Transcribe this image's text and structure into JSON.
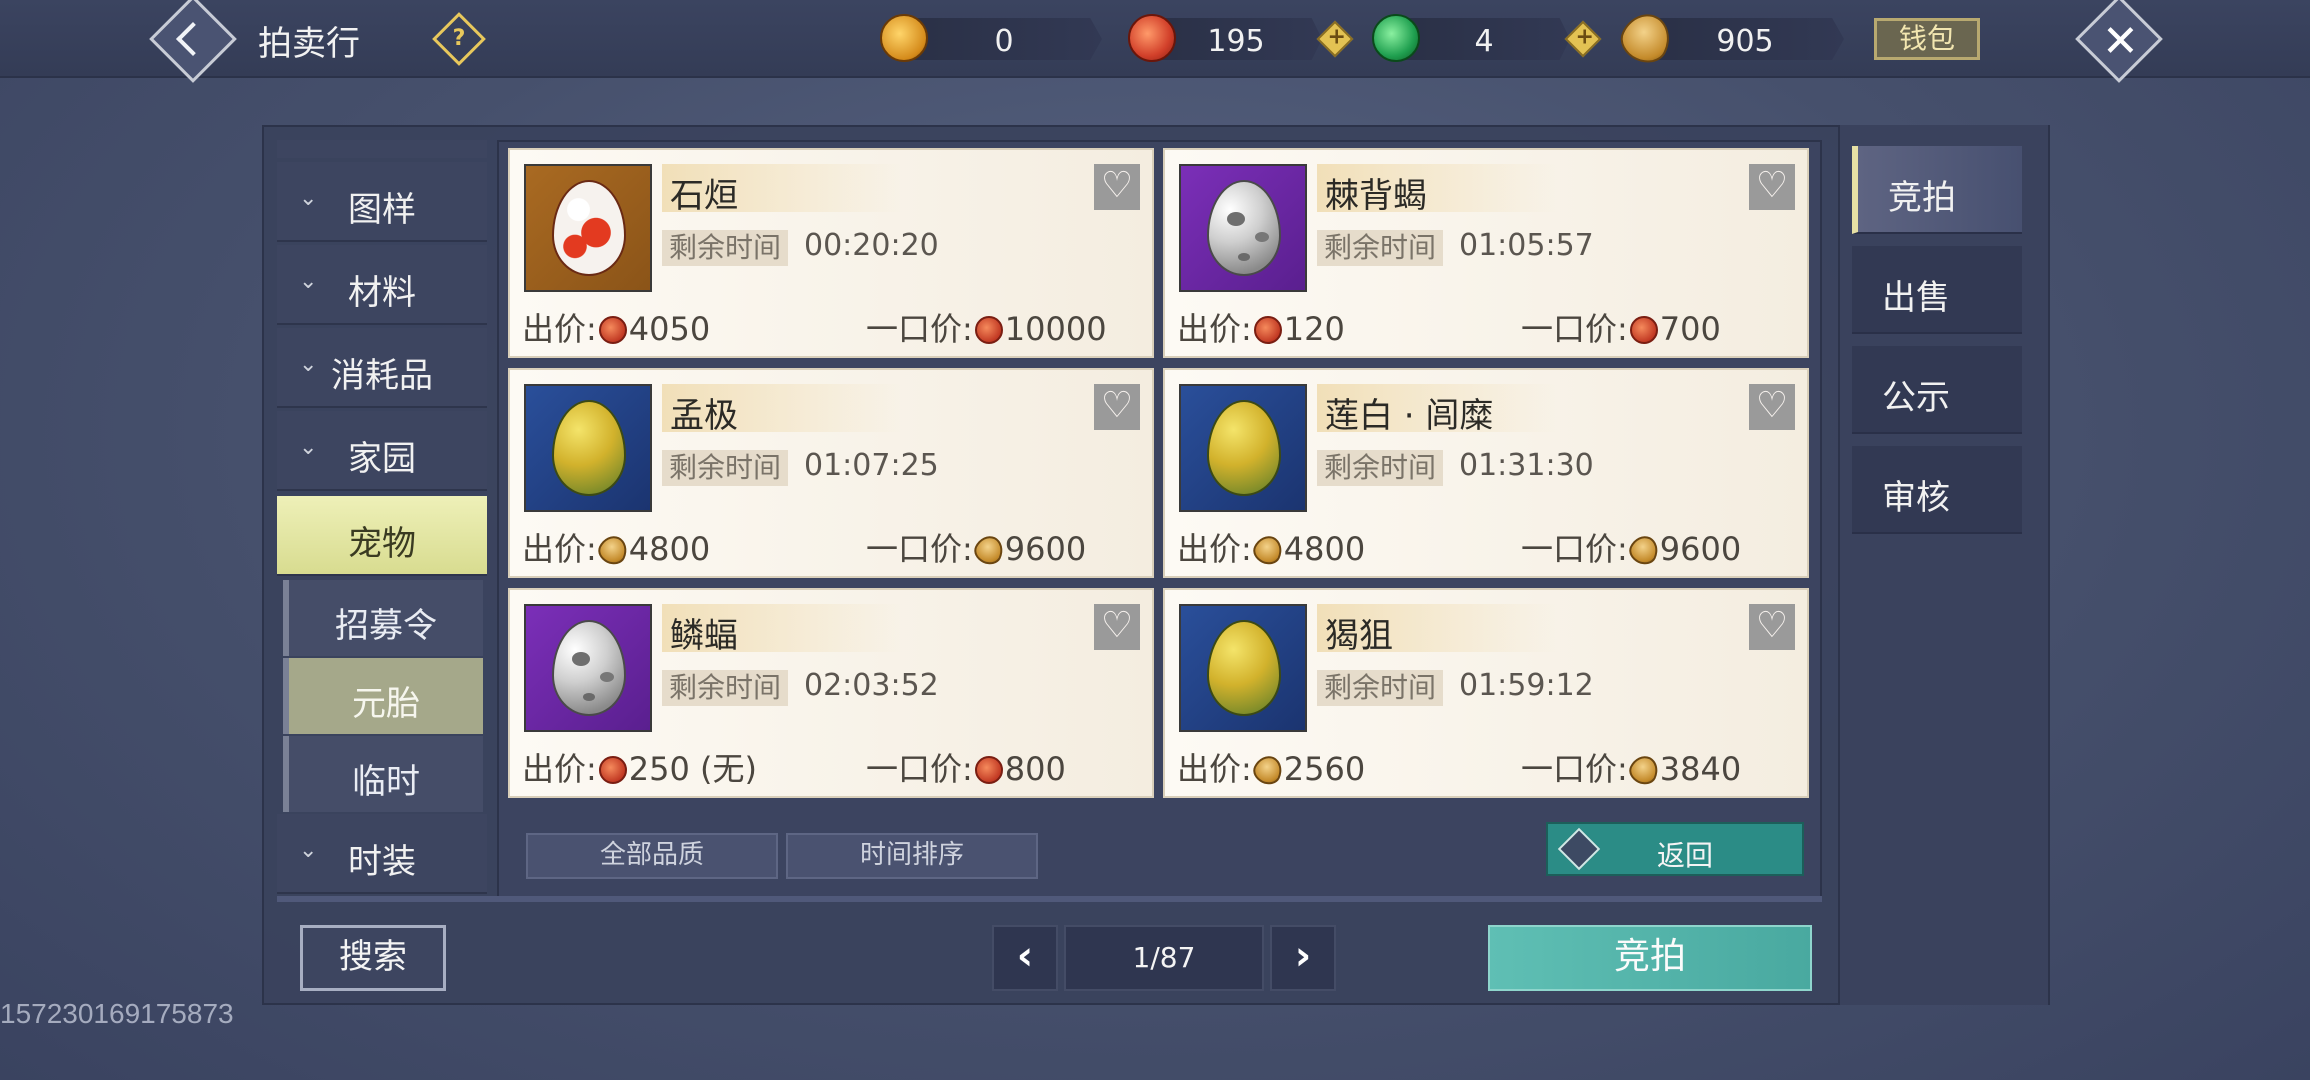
{
  "header": {
    "title": "拍卖行",
    "currencies": [
      {
        "icon": "golden-ring-currency-icon",
        "value": "0"
      },
      {
        "icon": "red-coin-currency-icon",
        "value": "195"
      },
      {
        "icon": "green-jade-currency-icon",
        "value": "4"
      },
      {
        "icon": "seed-currency-icon",
        "value": "905"
      }
    ],
    "wallet_label": "钱包"
  },
  "categories": [
    {
      "label": "图样",
      "expanded": false
    },
    {
      "label": "材料",
      "expanded": false
    },
    {
      "label": "消耗品",
      "expanded": false
    },
    {
      "label": "家园",
      "expanded": false
    },
    {
      "label": "宠物",
      "selected": true
    },
    {
      "label": "时装",
      "expanded": false
    }
  ],
  "subcategories": [
    {
      "label": "招募令"
    },
    {
      "label": "元胎",
      "selected": true
    },
    {
      "label": "临时"
    }
  ],
  "listings": [
    {
      "name": "石烜",
      "egg": "koi",
      "time_label": "剩余时间",
      "time": "00:20:20",
      "bid_label": "出价:",
      "bid": "4050",
      "bid_coin": "red",
      "buyout_label": "一口价:",
      "buyout": "10000",
      "buyout_coin": "red"
    },
    {
      "name": "棘背蝎",
      "egg": "moon",
      "time_label": "剩余时间",
      "time": "01:05:57",
      "bid_label": "出价:",
      "bid": "120",
      "bid_coin": "red",
      "buyout_label": "一口价:",
      "buyout": "700",
      "buyout_coin": "red"
    },
    {
      "name": "孟极",
      "egg": "scale",
      "time_label": "剩余时间",
      "time": "01:07:25",
      "bid_label": "出价:",
      "bid": "4800",
      "bid_coin": "seed",
      "buyout_label": "一口价:",
      "buyout": "9600",
      "buyout_coin": "seed"
    },
    {
      "name": "莲白 · 闾糜",
      "egg": "scale",
      "time_label": "剩余时间",
      "time": "01:31:30",
      "bid_label": "出价:",
      "bid": "4800",
      "bid_coin": "seed",
      "buyout_label": "一口价:",
      "buyout": "9600",
      "buyout_coin": "seed"
    },
    {
      "name": "鳞蝠",
      "egg": "moon",
      "time_label": "剩余时间",
      "time": "02:03:52",
      "bid_label": "出价:",
      "bid": "250 (无)",
      "bid_coin": "red",
      "buyout_label": "一口价:",
      "buyout": "800",
      "buyout_coin": "red"
    },
    {
      "name": "猲狙",
      "egg": "scale",
      "time_label": "剩余时间",
      "time": "01:59:12",
      "bid_label": "出价:",
      "bid": "2560",
      "bid_coin": "seed",
      "buyout_label": "一口价:",
      "buyout": "3840",
      "buyout_coin": "seed"
    }
  ],
  "filters": {
    "quality": "全部品质",
    "sort": "时间排序"
  },
  "back_label": "返回",
  "search_label": "搜索",
  "pagination": {
    "current": "1/87"
  },
  "bid_button_label": "竞拍",
  "right_tabs": [
    {
      "label": "竞拍",
      "selected": true
    },
    {
      "label": "出售"
    },
    {
      "label": "公示"
    },
    {
      "label": "审核"
    }
  ],
  "user_id": "157230169175873"
}
